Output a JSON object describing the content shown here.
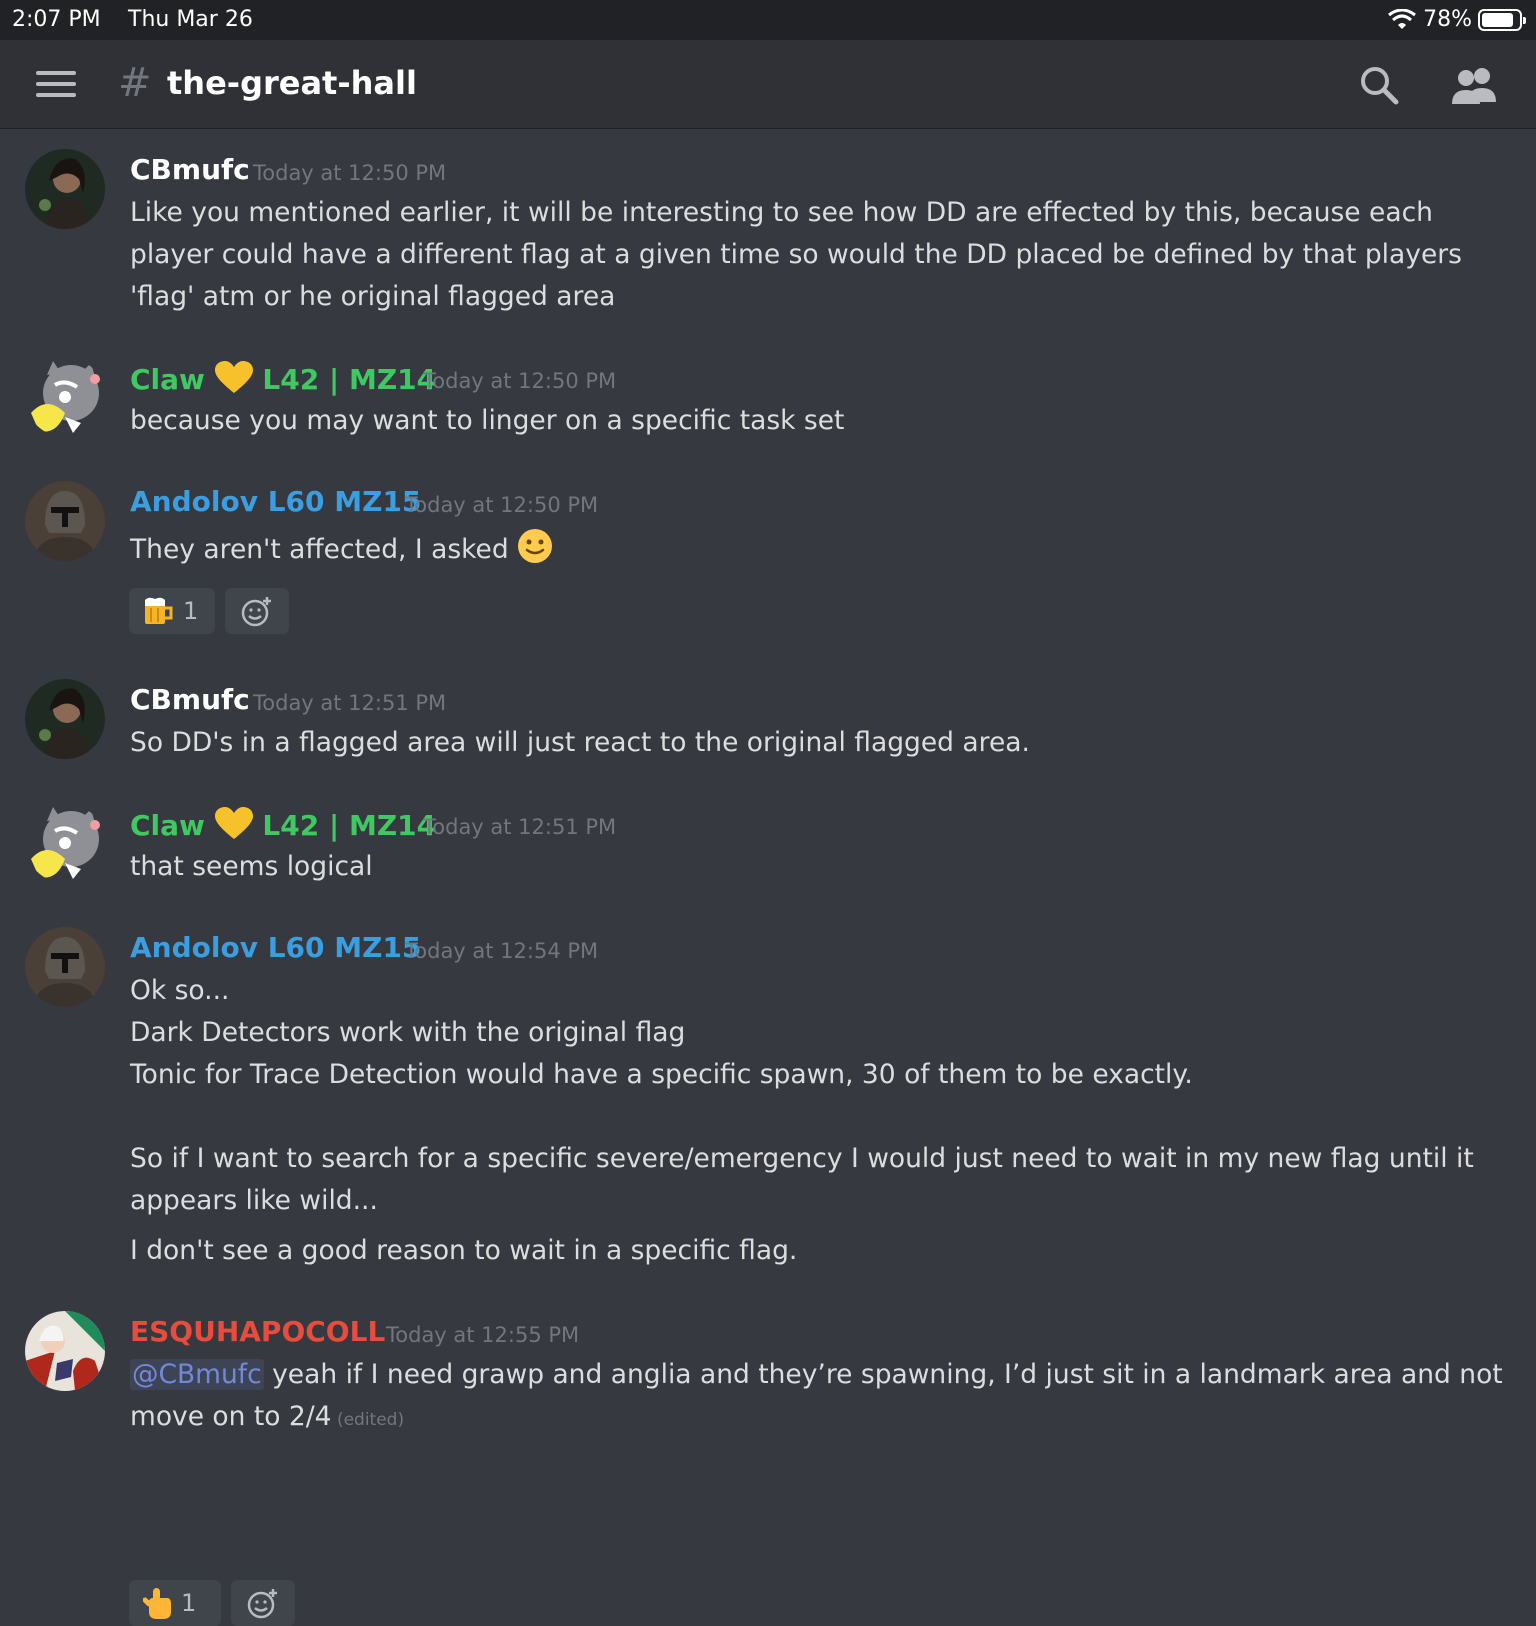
{
  "status_bar": {
    "time": "2:07 PM",
    "date": "Thu Mar 26",
    "battery": "78%",
    "battery_level": 0.78
  },
  "header": {
    "channel_name": "the-great-hall"
  },
  "messages": [
    {
      "author": "CBmufc",
      "time": "Today at 12:50 PM",
      "text": "Like you mentioned earlier, it will be interesting to see how DD are effected by this, because each player could have a different flag at a given time so would the DD placed be defined by that players 'flag' atm or he original flagged area"
    },
    {
      "author_name": "Claw",
      "author_suffix": "L42 | MZ14",
      "time": "Today at 12:50 PM",
      "text": "because you may want to linger on a specific task set"
    },
    {
      "author": "Andolov L60 MZ15",
      "time": "Today at 12:50 PM",
      "text": "They aren't affected, I asked",
      "reaction_count": "1"
    },
    {
      "author": "CBmufc",
      "time": "Today at 12:51 PM",
      "text": "So DD's in a flagged area will just react to the original flagged area."
    },
    {
      "author_name": "Claw",
      "author_suffix": "L42 | MZ14",
      "time": "Today at 12:51 PM",
      "text": "that seems logical"
    },
    {
      "author": "Andolov L60 MZ15",
      "time": "Today at 12:54 PM",
      "line1": "Ok so...",
      "line2": "Dark Detectors work with the original flag",
      "line3": "Tonic for Trace Detection would have a specific spawn, 30 of them to be exactly.",
      "line4": "So if I want to search for a specific severe/emergency I would just need to wait in my new flag until it appears like wild...",
      "line5": "I don't see a good reason to wait in a specific flag."
    },
    {
      "author": "ESQUHAPOCOLL",
      "time": "Today at 12:55 PM",
      "mention": "@CBmufc",
      "text": " yeah if I need grawp and anglia and they’re spawning, I’d just sit in a landmark area and not move on to 2/4",
      "edited": " (edited)",
      "reaction_count": "1"
    }
  ],
  "colors": {
    "background": "#36393f",
    "header": "#2f3136",
    "green_role": "#3ec961",
    "blue_role": "#3a9ee0",
    "red_role": "#e74c3c",
    "mention": "#7289da"
  }
}
